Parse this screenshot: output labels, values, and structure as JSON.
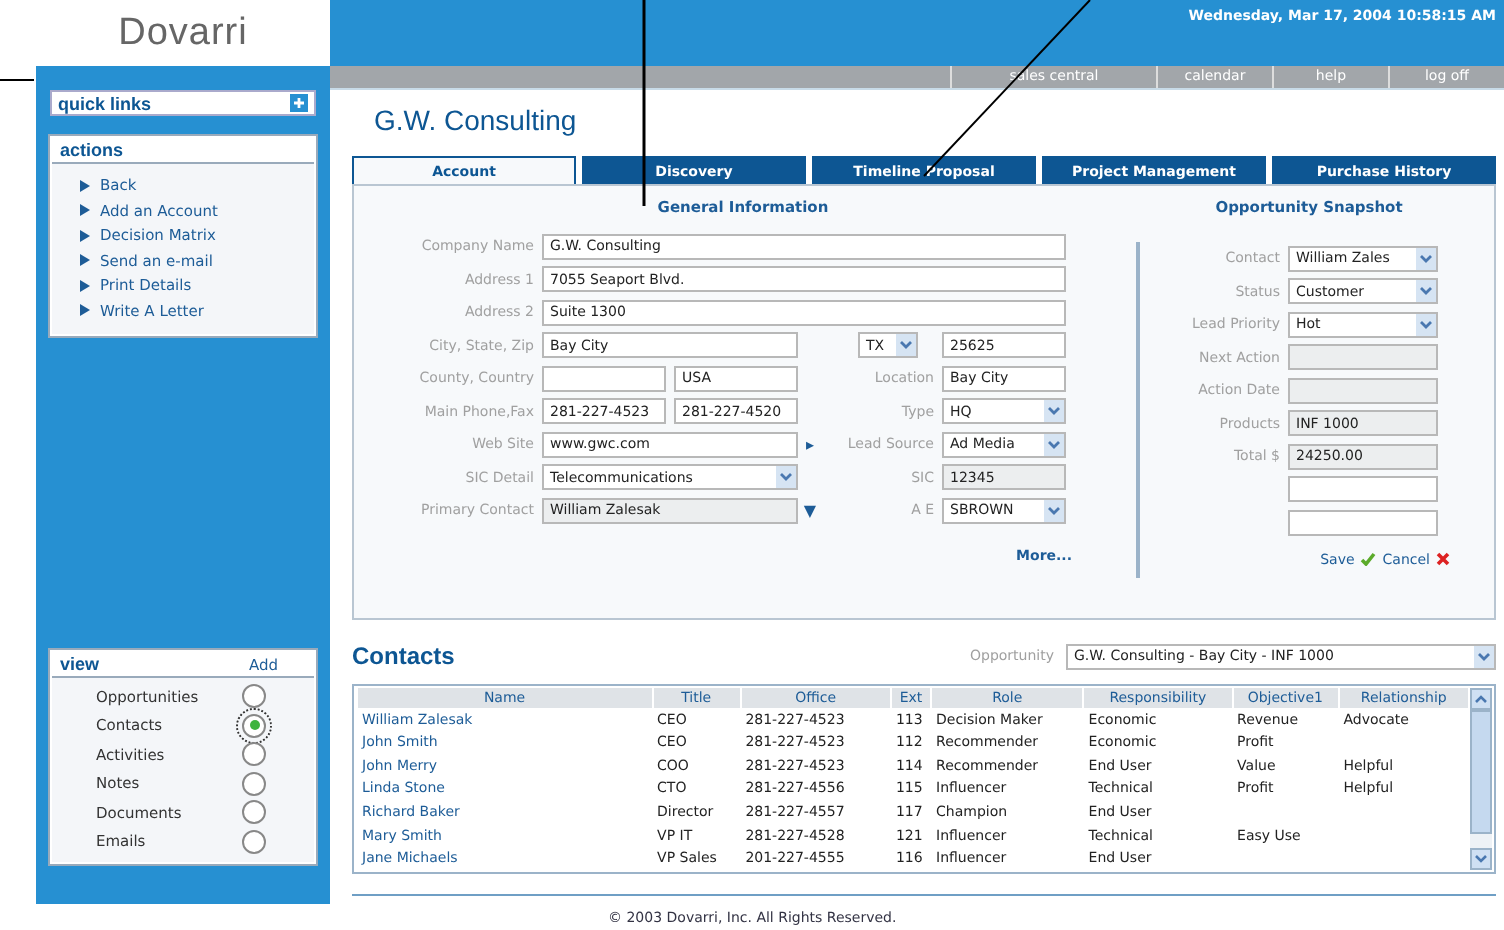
{
  "logo": {
    "text": "Dovarri"
  },
  "header": {
    "datetime": "Wednesday, Mar 17, 2004 10:58:15 AM",
    "nav": [
      "sales central",
      "calendar",
      "help",
      "log off"
    ]
  },
  "sidebar": {
    "quick_links": {
      "title": "quick links"
    },
    "actions": {
      "title": "actions",
      "items": [
        "Back",
        "Add an Account",
        "Decision Matrix",
        "Send an e-mail",
        "Print Details",
        "Write A Letter"
      ]
    },
    "view": {
      "title": "view",
      "add_label": "Add",
      "items": [
        {
          "label": "Opportunities",
          "selected": false
        },
        {
          "label": "Contacts",
          "selected": true
        },
        {
          "label": "Activities",
          "selected": false
        },
        {
          "label": "Notes",
          "selected": false
        },
        {
          "label": "Documents",
          "selected": false
        },
        {
          "label": "Emails",
          "selected": false
        }
      ]
    }
  },
  "page_title": "G.W. Consulting",
  "tabs": [
    {
      "label": "Account",
      "selected": true
    },
    {
      "label": "Discovery",
      "selected": false
    },
    {
      "label": "Timeline Proposal",
      "selected": false
    },
    {
      "label": "Project Management",
      "selected": false
    },
    {
      "label": "Purchase History",
      "selected": false
    }
  ],
  "general_information": {
    "title": "General Information",
    "rows": [
      {
        "label": "Company Name",
        "fields": [
          {
            "value": "G.W. Consulting",
            "kind": "text"
          }
        ]
      },
      {
        "label": "Address 1",
        "fields": [
          {
            "value": "7055 Seaport Blvd.",
            "kind": "text"
          }
        ]
      },
      {
        "label": "Address 2",
        "fields": [
          {
            "value": "Suite 1300",
            "kind": "text"
          }
        ]
      },
      {
        "label": "City, State, Zip",
        "fields": [
          {
            "value": "Bay City",
            "kind": "text"
          }
        ],
        "side": {
          "fields": [
            {
              "value": "TX",
              "kind": "select"
            },
            {
              "value": "25625",
              "kind": "text"
            }
          ]
        }
      },
      {
        "label": "County, Country",
        "fields": [
          {
            "kind": "text"
          },
          {
            "value": "USA",
            "kind": "text"
          }
        ],
        "side": {
          "label": "Location",
          "fields": [
            {
              "value": "Bay City",
              "kind": "text"
            }
          ]
        }
      },
      {
        "label": "Main Phone,Fax",
        "fields": [
          {
            "value": "281-227-4523",
            "kind": "text"
          },
          {
            "value": "281-227-4520",
            "kind": "text"
          }
        ],
        "side": {
          "label": "Type",
          "fields": [
            {
              "value": "HQ",
              "kind": "select"
            }
          ]
        }
      },
      {
        "label": "Web Site",
        "fields": [
          {
            "value": "www.gwc.com",
            "kind": "text"
          }
        ],
        "marker": "▸",
        "side": {
          "label": "Lead Source",
          "fields": [
            {
              "value": "Ad Media",
              "kind": "select"
            }
          ]
        }
      },
      {
        "label": "SIC Detail",
        "fields": [
          {
            "value": "Telecommunications",
            "kind": "select"
          }
        ],
        "side": {
          "label": "SIC",
          "fields": [
            {
              "value": "12345",
              "kind": "readonly"
            }
          ]
        }
      },
      {
        "label": "Primary Contact",
        "fields": [
          {
            "value": "William Zalesak",
            "kind": "readonly"
          }
        ],
        "marker": "▼",
        "side": {
          "label": "A E",
          "fields": [
            {
              "value": "SBROWN",
              "kind": "select"
            }
          ]
        }
      }
    ],
    "more_link": "More..."
  },
  "opportunity_snapshot": {
    "title": "Opportunity Snapshot",
    "rows": [
      {
        "label": "Contact",
        "value": "William Zales",
        "kind": "select"
      },
      {
        "label": "Status",
        "value": "Customer",
        "kind": "select"
      },
      {
        "label": "Lead Priority",
        "value": "Hot",
        "kind": "select"
      },
      {
        "label": "Next Action",
        "kind": "readonly"
      },
      {
        "label": "Action Date",
        "kind": "readonly"
      },
      {
        "label": "Products",
        "value": "INF 1000",
        "kind": "readonly"
      },
      {
        "label": "Total $",
        "value": "24250.00",
        "kind": "readonly"
      },
      {
        "kind": "text"
      },
      {
        "kind": "text"
      }
    ],
    "save": "Save",
    "cancel": "Cancel"
  },
  "contacts": {
    "title": "Contacts",
    "opportunity_label": "Opportunity",
    "opportunity_value": "G.W. Consulting - Bay City - INF 1000",
    "columns": [
      "Name",
      "Title",
      "Office",
      "Ext",
      "Role",
      "Responsibility",
      "Objective1",
      "Relationship"
    ],
    "rows": [
      [
        "William Zalesak",
        "CEO",
        "281-227-4523",
        "113",
        "Decision Maker",
        "Economic",
        "Revenue",
        "Advocate"
      ],
      [
        "John Smith",
        "CEO",
        "281-227-4523",
        "112",
        "Recommender",
        "Economic",
        "Profit",
        ""
      ],
      [
        "John Merry",
        "COO",
        "281-227-4523",
        "114",
        "Recommender",
        "End User",
        "Value",
        "Helpful"
      ],
      [
        "Linda Stone",
        "CTO",
        "281-227-4556",
        "115",
        "Influencer",
        "Technical",
        "Profit",
        "Helpful"
      ],
      [
        "Richard Baker",
        "Director",
        "281-227-4557",
        "117",
        "Champion",
        "End User",
        "",
        ""
      ],
      [
        "Mary Smith",
        "VP IT",
        "281-227-4528",
        "121",
        "Influencer",
        "Technical",
        "Easy Use",
        ""
      ],
      [
        "Jane Michaels",
        "VP Sales",
        "201-227-4555",
        "116",
        "Influencer",
        "End User",
        "",
        ""
      ]
    ]
  },
  "footer": "© 2003 Dovarri, Inc. All Rights Reserved."
}
